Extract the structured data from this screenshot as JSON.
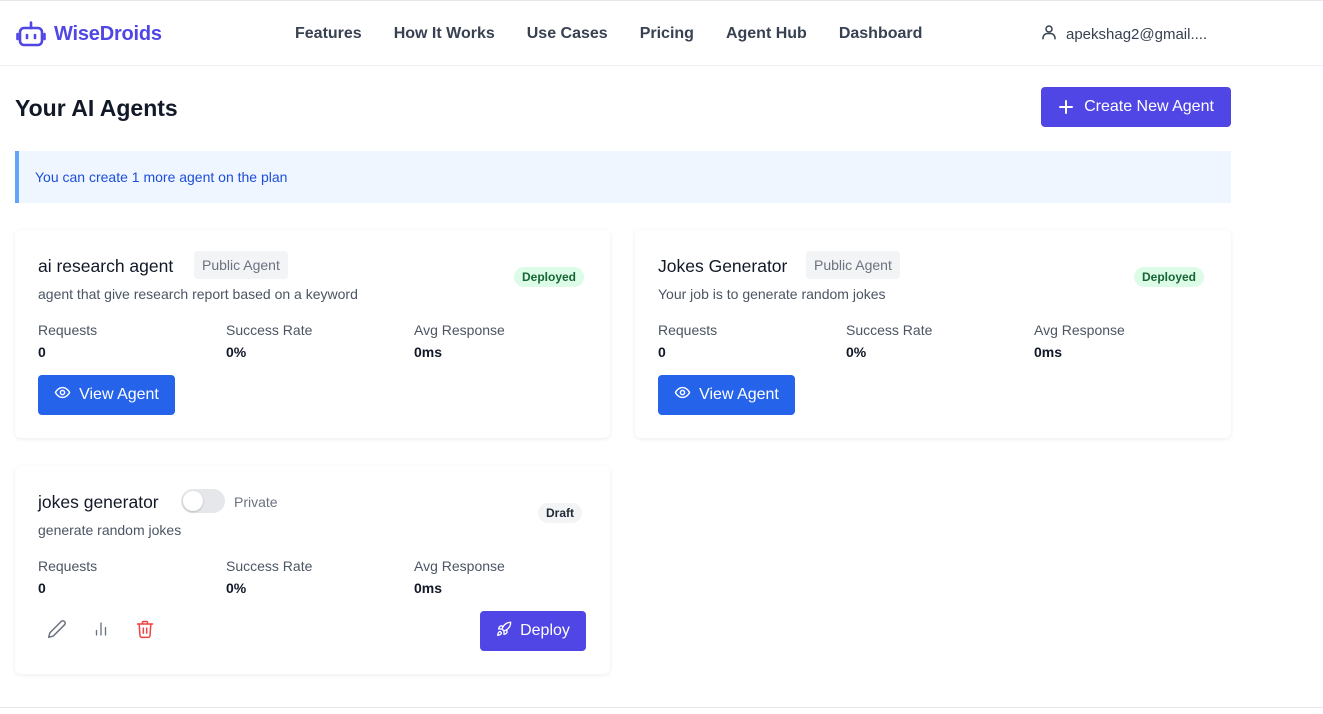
{
  "brand": {
    "name": "WiseDroids",
    "color": "#4f46e5",
    "icon": "robot-icon"
  },
  "nav": {
    "items": [
      {
        "label": "Features"
      },
      {
        "label": "How It Works"
      },
      {
        "label": "Use Cases"
      },
      {
        "label": "Pricing"
      },
      {
        "label": "Agent Hub"
      },
      {
        "label": "Dashboard"
      }
    ]
  },
  "user": {
    "email": "apekshag2@gmail....",
    "icon": "user-icon"
  },
  "page": {
    "title": "Your AI Agents",
    "create_button": "Create New Agent",
    "notice": "You can create 1 more agent on the plan"
  },
  "metric_labels": {
    "requests": "Requests",
    "success_rate": "Success Rate",
    "avg_response": "Avg Response"
  },
  "agents": [
    {
      "name": "ai research agent",
      "visibility": "Public Agent",
      "status": "Deployed",
      "description": "agent that give research report based on a keyword",
      "requests": "0",
      "success_rate": "0%",
      "avg_response": "0ms",
      "action": "View Agent"
    },
    {
      "name": "Jokes Generator",
      "visibility": "Public Agent",
      "status": "Deployed",
      "description": "Your job is to generate random jokes",
      "requests": "0",
      "success_rate": "0%",
      "avg_response": "0ms",
      "action": "View Agent"
    },
    {
      "name": "jokes generator",
      "visibility_toggle": "Private",
      "toggle_on": false,
      "status": "Draft",
      "description": "generate random jokes",
      "requests": "0",
      "success_rate": "0%",
      "avg_response": "0ms",
      "action": "Deploy"
    }
  ],
  "colors": {
    "primary": "#4f46e5",
    "view_button": "#2563eb",
    "deployed_bg": "#dcfce7",
    "deployed_text": "#166534",
    "delete": "#ef4444",
    "notice_bg": "#eff6ff",
    "notice_border": "#60a5fa"
  }
}
